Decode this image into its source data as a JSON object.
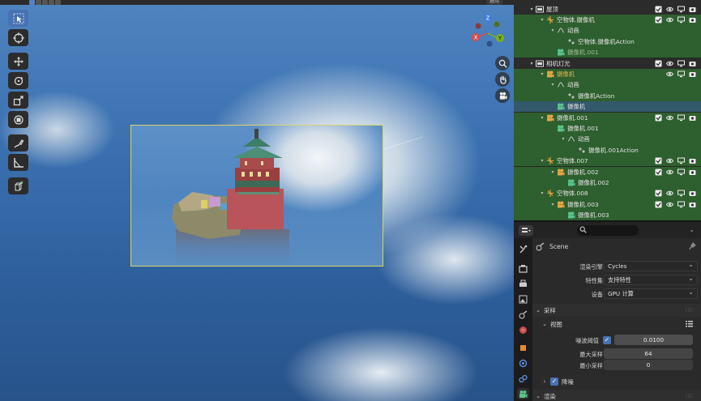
{
  "viewport": {
    "top_tag": "选用",
    "tools": [
      "select-box",
      "cursor",
      "move",
      "rotate",
      "scale",
      "transform",
      "annotate",
      "measure",
      "add-cube"
    ],
    "gizmo_axes": [
      "Z",
      "Y",
      "X"
    ],
    "nav_buttons": [
      "zoom",
      "pan",
      "camera"
    ]
  },
  "outliner": {
    "rows": [
      {
        "label": "屋顶",
        "depth": 1,
        "icon": "collection-icon",
        "style": "dark",
        "vis": "full"
      },
      {
        "label": "空物体.摄像机",
        "depth": 2,
        "icon": "empty-icon",
        "style": "green",
        "vis": "full"
      },
      {
        "label": "动画",
        "depth": 3,
        "icon": "anim-icon",
        "style": "green",
        "vis": "none"
      },
      {
        "label": "空物体.摄像机Action",
        "depth": 4,
        "icon": "action-icon",
        "style": "green",
        "vis": "none"
      },
      {
        "label": "摄像机.001",
        "depth": 3,
        "icon": "camera-data-icon",
        "style": "green",
        "vis": "none",
        "dim": true
      },
      {
        "label": "相机灯光",
        "depth": 1,
        "icon": "collection-icon",
        "style": "dark",
        "vis": "full"
      },
      {
        "label": "摄像机",
        "depth": 2,
        "icon": "camera-icon",
        "style": "green",
        "vis": "eye-cam",
        "gold": true
      },
      {
        "label": "动画",
        "depth": 3,
        "icon": "anim-icon",
        "style": "green",
        "vis": "none"
      },
      {
        "label": "摄像机Action",
        "depth": 4,
        "icon": "action-icon",
        "style": "green",
        "vis": "none"
      },
      {
        "label": "摄像机",
        "depth": 3,
        "icon": "camera-data-icon",
        "style": "blue",
        "vis": "none"
      },
      {
        "label": "摄像机.001",
        "depth": 2,
        "icon": "camera-icon",
        "style": "green",
        "vis": "full"
      },
      {
        "label": "摄像机.001",
        "depth": 3,
        "icon": "camera-data-icon",
        "style": "green",
        "vis": "none"
      },
      {
        "label": "动画",
        "depth": 4,
        "icon": "anim-icon",
        "style": "green",
        "vis": "none"
      },
      {
        "label": "摄像机.001Action",
        "depth": 5,
        "icon": "action-icon",
        "style": "green",
        "vis": "none"
      },
      {
        "label": "空物体.007",
        "depth": 2,
        "icon": "empty-icon",
        "style": "green",
        "vis": "full"
      },
      {
        "label": "摄像机.002",
        "depth": 3,
        "icon": "camera-icon",
        "style": "green",
        "vis": "full"
      },
      {
        "label": "摄像机.002",
        "depth": 4,
        "icon": "camera-data-icon",
        "style": "green",
        "vis": "none"
      },
      {
        "label": "空物体.008",
        "depth": 2,
        "icon": "empty-icon",
        "style": "green",
        "vis": "full"
      },
      {
        "label": "摄像机.003",
        "depth": 3,
        "icon": "camera-icon",
        "style": "green",
        "vis": "full"
      },
      {
        "label": "摄像机.003",
        "depth": 4,
        "icon": "camera-data-icon",
        "style": "green",
        "vis": "none"
      }
    ]
  },
  "properties": {
    "scene_name": "Scene",
    "render_engine_label": "渲染引擎",
    "render_engine_value": "Cycles",
    "feature_set_label": "特性集",
    "feature_set_value": "支持特性",
    "device_label": "设备",
    "device_value": "GPU 计算",
    "sampling_label": "采样",
    "viewport_label": "视图",
    "noise_threshold_label": "噪波阈值",
    "noise_threshold_value": "0.0100",
    "max_samples_label": "最大采样",
    "max_samples_value": "64",
    "min_samples_label": "最小采样",
    "min_samples_value": "0",
    "denoise_label": "降噪",
    "render_label": "渲染"
  },
  "colors": {
    "accent": "#4772b3",
    "outliner_selected": "#2e5f2e",
    "outliner_active": "#33596b",
    "camera_frame": "#d9d46a"
  }
}
